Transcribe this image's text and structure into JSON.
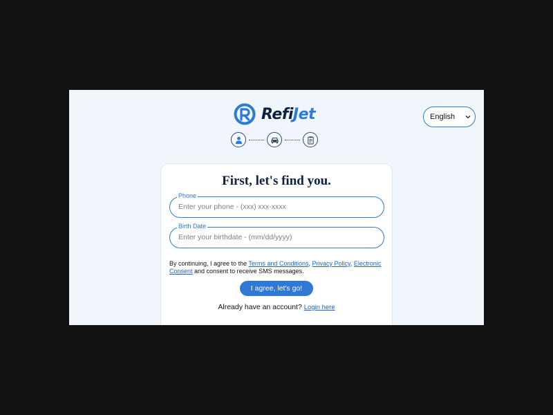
{
  "brand": {
    "name_part1": "Refi",
    "name_part2": "Jet",
    "logo_icon": "refijet-logo-icon"
  },
  "progress_steps": [
    {
      "icon": "person-icon"
    },
    {
      "icon": "car-icon"
    },
    {
      "icon": "clipboard-icon"
    }
  ],
  "language": {
    "selected": "English"
  },
  "form": {
    "title": "First, let's find you.",
    "phone": {
      "label": "Phone",
      "placeholder": "Enter your phone - (xxx) xxx-xxxx",
      "value": ""
    },
    "birthdate": {
      "label": "Birth Date",
      "placeholder": "Enter your birthdate - (mm/dd/yyyy)",
      "value": ""
    },
    "consent": {
      "prefix": "By continuing, I agree to the ",
      "terms_link": "Terms and Conditions",
      "sep1": ", ",
      "privacy_link": "Privacy Policy",
      "sep2": ", ",
      "econsent_link": "Electronic Consent",
      "suffix": " and consent to receive SMS messages."
    },
    "submit_label": "I agree, let's go!",
    "login_prompt": "Already have an account? ",
    "login_link": "Login here"
  },
  "colors": {
    "accent": "#2a7ad6",
    "navy": "#0d2240",
    "page_bg": "#f1f6fd",
    "outer_bg": "#111111"
  }
}
